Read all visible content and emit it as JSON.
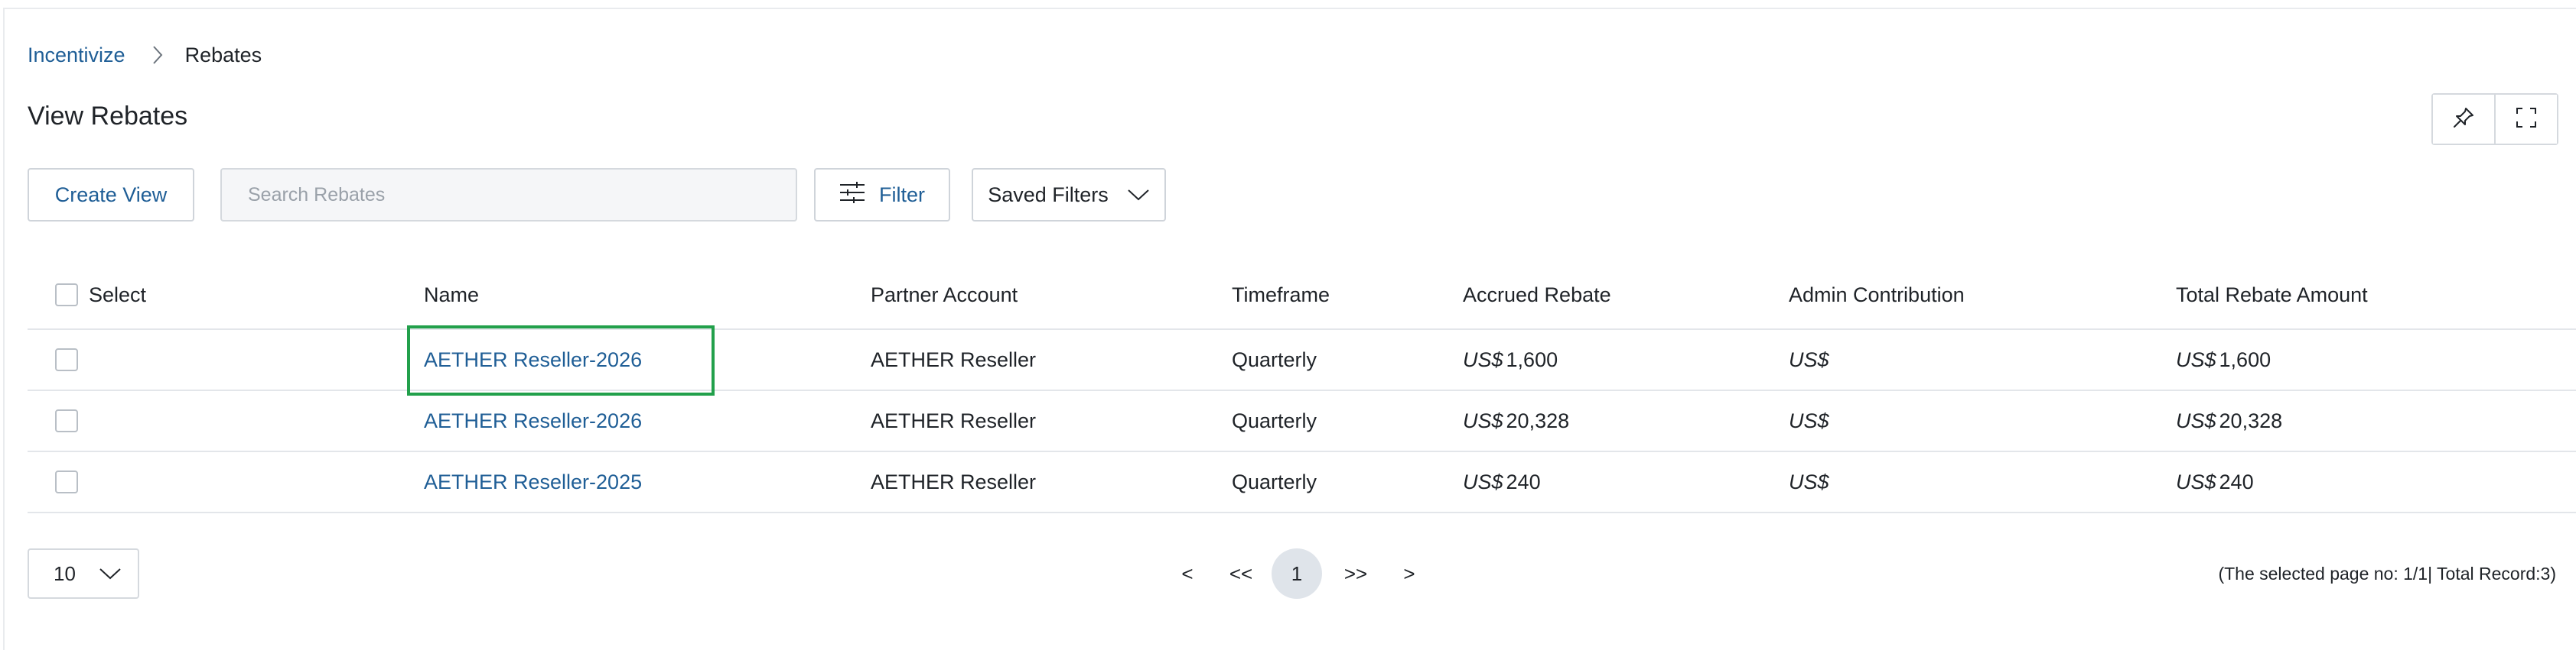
{
  "breadcrumb": {
    "parent": "Incentivize",
    "current": "Rebates"
  },
  "page": {
    "title": "View Rebates"
  },
  "toolbar": {
    "create_view": "Create View",
    "search_placeholder": "Search Rebates",
    "filter": "Filter",
    "saved_filters": "Saved Filters"
  },
  "table": {
    "headers": {
      "select": "Select",
      "name": "Name",
      "partner_account": "Partner Account",
      "timeframe": "Timeframe",
      "accrued_rebate": "Accrued Rebate",
      "admin_contribution": "Admin Contribution",
      "total_rebate_amount": "Total Rebate Amount"
    },
    "currency": "US$",
    "rows": [
      {
        "name": "AETHER Reseller-2026",
        "partner_account": "AETHER Reseller",
        "timeframe": "Quarterly",
        "accrued_rebate": "1,600",
        "admin_contribution": "",
        "total_rebate_amount": "1,600"
      },
      {
        "name": "AETHER Reseller-2026",
        "partner_account": "AETHER Reseller",
        "timeframe": "Quarterly",
        "accrued_rebate": "20,328",
        "admin_contribution": "",
        "total_rebate_amount": "20,328"
      },
      {
        "name": "AETHER Reseller-2025",
        "partner_account": "AETHER Reseller",
        "timeframe": "Quarterly",
        "accrued_rebate": "240",
        "admin_contribution": "",
        "total_rebate_amount": "240"
      }
    ]
  },
  "pagination": {
    "page_size": "10",
    "prev": "<",
    "first": "<<",
    "current_page": "1",
    "last": ">>",
    "next": ">",
    "status": "(The selected page no: 1/1| Total Record:3)"
  },
  "colors": {
    "link": "#1f5e96",
    "highlight": "#22a04b",
    "current_page_bg": "#dfe4ea"
  },
  "icons": {
    "breadcrumb_separator": "chevron-right-icon",
    "pin": "pin-icon",
    "fullscreen": "fullscreen-icon",
    "filter": "sliders-icon",
    "saved_filters": "chevron-down-icon",
    "page_size": "chevron-down-icon"
  }
}
